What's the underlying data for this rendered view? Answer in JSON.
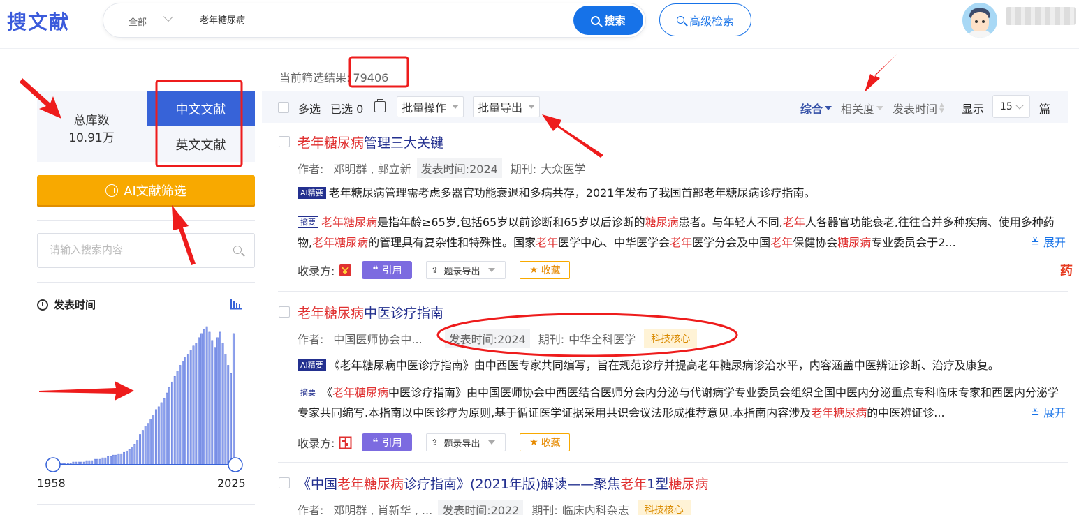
{
  "header": {
    "logo": "搜文献",
    "search_scope": "全部",
    "search_query": "老年糖尿病",
    "search_button": "搜索",
    "advanced_button": "高级检索"
  },
  "left": {
    "library_title": "总库数",
    "library_count": "10.91万",
    "tab_zh": "中文文献",
    "tab_en": "英文文献",
    "ai_filter": "AI文献筛选",
    "search_placeholder": "请输入搜索内容",
    "time_filter_title": "发表时间",
    "year_start": "1958",
    "year_end": "2025"
  },
  "chart_data": {
    "type": "bar",
    "x_range": [
      1958,
      2025
    ],
    "values": [
      1,
      1,
      1,
      1,
      1,
      1,
      1,
      2,
      2,
      2,
      2,
      2,
      3,
      3,
      3,
      4,
      4,
      4,
      5,
      5,
      6,
      6,
      7,
      7,
      8,
      8,
      9,
      10,
      11,
      13,
      15,
      18,
      22,
      25,
      28,
      30,
      33,
      36,
      40,
      42,
      45,
      48,
      52,
      56,
      60,
      64,
      68,
      72,
      75,
      78,
      80,
      83,
      86,
      88,
      92,
      95,
      98,
      100,
      96,
      90,
      85,
      92,
      96,
      88,
      80,
      72,
      66,
      95
    ]
  },
  "results_summary": {
    "label": "当前筛选结果:",
    "count": "79406"
  },
  "toolbar": {
    "multi_select": "多选",
    "selected": "已选 0",
    "batch_ops": "批量操作",
    "batch_export": "批量导出",
    "sort_default": "综合",
    "sort_relevance": "相关度",
    "sort_date": "发表时间",
    "display_label": "显示",
    "page_size": "15",
    "unit": "篇"
  },
  "labels": {
    "author": "作者:",
    "pub_time": "发表时间:",
    "journal": "期刊:",
    "ai_tag": "AI精要",
    "abstract_tag": "摘要",
    "expand": "展开",
    "source_label": "收录方:",
    "cite": "引用",
    "title_export": "题录导出",
    "favorite": "收藏"
  },
  "results": [
    {
      "title_hl": "老年糖尿病",
      "title_rest": "管理三大关键",
      "authors": "邓明群 , 郭立新",
      "year": "2024",
      "journal": "大众医学",
      "ai_summary": "老年糖尿病管理需考虑多器官功能衰退和多病共存，2021年发布了我国首部老年糖尿病诊疗指南。",
      "abstract_parts": [
        {
          "t": "老年糖尿病",
          "h": true
        },
        {
          "t": "是指年龄≥65岁,包括65岁以前诊断和65岁以后诊断的",
          "h": false
        },
        {
          "t": "糖尿病",
          "h": true
        },
        {
          "t": "患者。与年轻人不同,",
          "h": false
        },
        {
          "t": "老年",
          "h": true
        },
        {
          "t": "人各器官功能衰老,往往合并多种疾病、使用多种药物,",
          "h": false
        },
        {
          "t": "老年糖尿病",
          "h": true
        },
        {
          "t": "的管理具有复杂性和特殊性。国家",
          "h": false
        },
        {
          "t": "老年",
          "h": true
        },
        {
          "t": "医学中心、中华医学会",
          "h": false
        },
        {
          "t": "老年",
          "h": true
        },
        {
          "t": "医学分会及中国",
          "h": false
        },
        {
          "t": "老年",
          "h": true
        },
        {
          "t": "保健协会",
          "h": false
        },
        {
          "t": "糖尿病",
          "h": true
        },
        {
          "t": "专业委员会于2...",
          "h": false
        }
      ]
    },
    {
      "title_hl": "老年糖尿病",
      "title_rest": "中医诊疗指南",
      "authors": "中国医师协会中...",
      "year": "2024",
      "journal": "中华全科医学",
      "core_badge": "科技核心",
      "ai_summary": "《老年糖尿病中医诊疗指南》由中西医专家共同编写，旨在规范诊疗并提高老年糖尿病诊治水平，内容涵盖中医辨证诊断、治疗及康复。",
      "abstract_parts": [
        {
          "t": "《",
          "h": false
        },
        {
          "t": "老年糖尿病",
          "h": true
        },
        {
          "t": "中医诊疗指南》由中国医师协会中西医结合医师分会内分泌与代谢病学专业委员会组织全国中医内分泌重点专科临床专家和西医内分泌学专家共同编写.本指南以中医诊疗为原则,基于循证医学证据采用共识会议法形成推荐意见.本指南内容涉及",
          "h": false
        },
        {
          "t": "老年糖尿病",
          "h": true
        },
        {
          "t": "的中医辨证诊...",
          "h": false
        }
      ]
    },
    {
      "title_parts": [
        {
          "t": "《中国",
          "h": false
        },
        {
          "t": "老年糖尿病",
          "h": true
        },
        {
          "t": "诊疗指南》(2021年版)解读——聚焦",
          "h": false
        },
        {
          "t": "老年",
          "h": true
        },
        {
          "t": "1型",
          "h": false
        },
        {
          "t": "糖尿病",
          "h": true
        }
      ],
      "authors": "邓明群 , 肖新华 , ...",
      "year": "2022",
      "journal": "临床内科杂志",
      "core_badge": "科技核心"
    }
  ],
  "colors": {
    "primary": "#1672e8",
    "tab_active": "#3763d8",
    "ai_button": "#f8a900",
    "highlight": "#e03131",
    "annotation": "#ee1c1c"
  },
  "side_deco": "药"
}
